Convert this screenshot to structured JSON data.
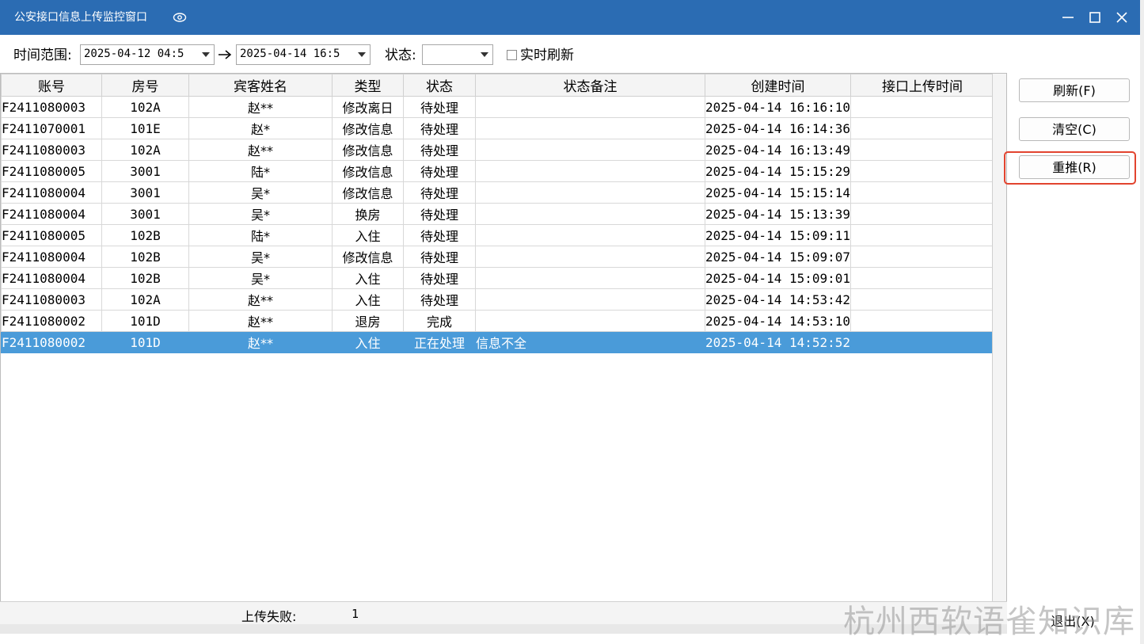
{
  "window": {
    "title": "公安接口信息上传监控窗口"
  },
  "filters": {
    "time_range_label": "时间范围:",
    "start_time": "2025-04-12 04:5",
    "end_time": "2025-04-14 16:5",
    "status_label": "状态:",
    "status_value": "",
    "realtime_label": "实时刷新",
    "realtime_checked": false
  },
  "table": {
    "columns": [
      "账号",
      "房号",
      "宾客姓名",
      "类型",
      "状态",
      "状态备注",
      "创建时间",
      "接口上传时间"
    ],
    "rows": [
      {
        "account": "F2411080003",
        "room": "102A",
        "guest": "赵**",
        "type": "修改离日",
        "status": "待处理",
        "note": "",
        "created": "2025-04-14 16:16:10",
        "uploaded": ""
      },
      {
        "account": "F2411070001",
        "room": "101E",
        "guest": "赵*",
        "type": "修改信息",
        "status": "待处理",
        "note": "",
        "created": "2025-04-14 16:14:36",
        "uploaded": ""
      },
      {
        "account": "F2411080003",
        "room": "102A",
        "guest": "赵**",
        "type": "修改信息",
        "status": "待处理",
        "note": "",
        "created": "2025-04-14 16:13:49",
        "uploaded": ""
      },
      {
        "account": "F2411080005",
        "room": "3001",
        "guest": "陆*",
        "type": "修改信息",
        "status": "待处理",
        "note": "",
        "created": "2025-04-14 15:15:29",
        "uploaded": ""
      },
      {
        "account": "F2411080004",
        "room": "3001",
        "guest": "吴*",
        "type": "修改信息",
        "status": "待处理",
        "note": "",
        "created": "2025-04-14 15:15:14",
        "uploaded": ""
      },
      {
        "account": "F2411080004",
        "room": "3001",
        "guest": "吴*",
        "type": "换房",
        "status": "待处理",
        "note": "",
        "created": "2025-04-14 15:13:39",
        "uploaded": ""
      },
      {
        "account": "F2411080005",
        "room": "102B",
        "guest": "陆*",
        "type": "入住",
        "status": "待处理",
        "note": "",
        "created": "2025-04-14 15:09:11",
        "uploaded": ""
      },
      {
        "account": "F2411080004",
        "room": "102B",
        "guest": "吴*",
        "type": "修改信息",
        "status": "待处理",
        "note": "",
        "created": "2025-04-14 15:09:07",
        "uploaded": ""
      },
      {
        "account": "F2411080004",
        "room": "102B",
        "guest": "吴*",
        "type": "入住",
        "status": "待处理",
        "note": "",
        "created": "2025-04-14 15:09:01",
        "uploaded": ""
      },
      {
        "account": "F2411080003",
        "room": "102A",
        "guest": "赵**",
        "type": "入住",
        "status": "待处理",
        "note": "",
        "created": "2025-04-14 14:53:42",
        "uploaded": ""
      },
      {
        "account": "F2411080002",
        "room": "101D",
        "guest": "赵**",
        "type": "退房",
        "status": "完成",
        "note": "",
        "created": "2025-04-14 14:53:10",
        "uploaded": ""
      },
      {
        "account": "F2411080002",
        "room": "101D",
        "guest": "赵**",
        "type": "入住",
        "status": "正在处理",
        "note": "信息不全",
        "created": "2025-04-14 14:52:52",
        "uploaded": "",
        "selected": true
      }
    ]
  },
  "footer": {
    "fail_label": "上传失败:",
    "fail_count": "1"
  },
  "buttons": {
    "refresh": "刷新(F)",
    "clear": "清空(C)",
    "repush": "重推(R)",
    "exit": "退出(X)"
  },
  "watermark": "杭州西软语雀知识库",
  "colors": {
    "titlebar": "#2b6cb3",
    "selected_row": "#4a9bd9",
    "highlight": "#e2442f"
  },
  "icons": {
    "title_suffix": "eye-icon",
    "minimize": "minimize-icon",
    "maximize": "maximize-icon",
    "close": "close-icon",
    "range_separator": "arrow-right-icon",
    "dropdown": "chevron-down-icon"
  }
}
